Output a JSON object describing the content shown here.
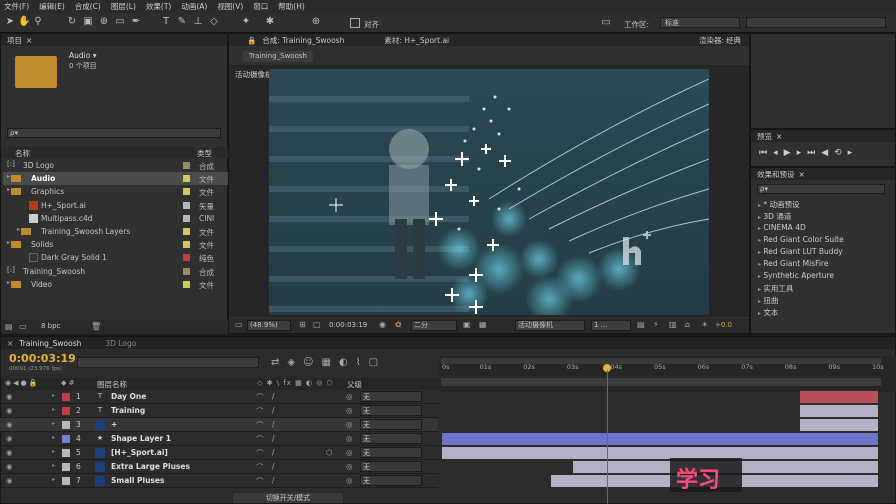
{
  "menu": [
    "文件(F)",
    "编辑(E)",
    "合成(C)",
    "图层(L)",
    "效果(T)",
    "动画(A)",
    "视图(V)",
    "窗口",
    "帮助(H)"
  ],
  "toolbar": {
    "snap_label": "对齐",
    "workspace_label": "工作区:",
    "workspace_value": "标准"
  },
  "project": {
    "tab": "项目",
    "selected_name": "Audio ▾",
    "selected_info": "0 个项目",
    "search_placeholder": "ρ▾",
    "col_name": "名称",
    "col_type": "类型",
    "rows": [
      {
        "name": "3D Logo",
        "type": "合成",
        "color": "#9c8d63",
        "icon": "[:]",
        "indent": 0
      },
      {
        "name": "Audio",
        "type": "文件",
        "color": "#d6c85a",
        "icon": "folder",
        "indent": 0
      },
      {
        "name": "Graphics",
        "type": "文件",
        "color": "#d6c85a",
        "icon": "folder",
        "indent": 0
      },
      {
        "name": "H+_Sport.ai",
        "type": "矢量",
        "color": "#b8b8b8",
        "icon": "ai",
        "indent": 1
      },
      {
        "name": "Multipass.c4d",
        "type": "CINI",
        "color": "#b8b8b8",
        "icon": "c4d",
        "indent": 1
      },
      {
        "name": "Training_Swoosh Layers",
        "type": "文件",
        "color": "#d6c85a",
        "icon": "folder",
        "indent": 1
      },
      {
        "name": "Solids",
        "type": "文件",
        "color": "#d6c85a",
        "icon": "folder",
        "indent": 0
      },
      {
        "name": "Dark Gray Solid 1",
        "type": "纯色",
        "color": "#c0404a",
        "icon": "solid",
        "indent": 1
      },
      {
        "name": "Training_Swoosh",
        "type": "合成",
        "color": "#9c8d63",
        "icon": "[:]",
        "indent": 0
      },
      {
        "name": "Video",
        "type": "文件",
        "color": "#d6c85a",
        "icon": "folder",
        "indent": 0
      }
    ],
    "bpc": "8 bpc"
  },
  "viewer": {
    "comp_tab": "合成: Training_Swoosh",
    "footage_tab": "素材: H+_Sport.ai",
    "renderer_label": "渲染器:",
    "renderer_value": "经典",
    "comp_chip": "Training_Swoosh",
    "camera_label": "活动摄像机",
    "zoom": "(48.9%)",
    "timecode": "0:00:03:19",
    "resolution": "二分",
    "camera_menu": "活动摄像机",
    "view_count": "1 ...",
    "exposure": "+0.0"
  },
  "preview": {
    "tab": "预览"
  },
  "effects": {
    "tab": "效果和预设",
    "search": "ρ▾",
    "items": [
      "* 动画预设",
      "3D 通道",
      "CINEMA 4D",
      "Red Giant Color Suite",
      "Red Giant LUT Buddy",
      "Red Giant MisFire",
      "Synthetic Aperture",
      "实用工具",
      "扭曲",
      "文本"
    ]
  },
  "timeline": {
    "tab_active": "Training_Swoosh",
    "tab_other": "3D Logo",
    "timecode": "0:00:03:19",
    "timecode_sub": "00091 (23.976 fps)",
    "layer_name_header": "图层名称",
    "parent_header": "父级",
    "toggle_label": "切换开关/模式",
    "ruler": [
      "0s",
      "01s",
      "02s",
      "03s",
      "04s",
      "05s",
      "06s",
      "07s",
      "08s",
      "09s",
      "10s"
    ],
    "current_time_seconds": 3.79,
    "parent_value": "无",
    "layers": [
      {
        "num": "1",
        "name": "Day One",
        "color": "#c0404a",
        "icon": "T",
        "bar_start": 8.2,
        "bar_end": 10,
        "bar_color": "#b8525a"
      },
      {
        "num": "2",
        "name": "Training",
        "color": "#c0404a",
        "icon": "T",
        "bar_start": 8.2,
        "bar_end": 10,
        "bar_color": "#b4b0c6"
      },
      {
        "num": "3",
        "name": "+",
        "color": "#b8b8b8",
        "icon": "ai",
        "bar_start": 8.2,
        "bar_end": 10,
        "bar_color": "#b4b0c6"
      },
      {
        "num": "4",
        "name": "Shape Layer 1",
        "color": "#6f7ed8",
        "icon": "★",
        "bar_start": 0,
        "bar_end": 10,
        "bar_color": "#6e74cc"
      },
      {
        "num": "5",
        "name": "[H+_Sport.ai]",
        "color": "#b8b8b8",
        "icon": "ai",
        "bar_start": 0,
        "bar_end": 10,
        "bar_color": "#b4b0c6"
      },
      {
        "num": "6",
        "name": "Extra Large Pluses",
        "color": "#b8b8b8",
        "icon": "ai",
        "bar_start": 3,
        "bar_end": 10,
        "bar_color": "#b4b0c6"
      },
      {
        "num": "7",
        "name": "Small Pluses",
        "color": "#b8b8b8",
        "icon": "ai",
        "bar_start": 2.5,
        "bar_end": 10,
        "bar_color": "#b4b0c6"
      }
    ]
  },
  "watermark": "学习"
}
